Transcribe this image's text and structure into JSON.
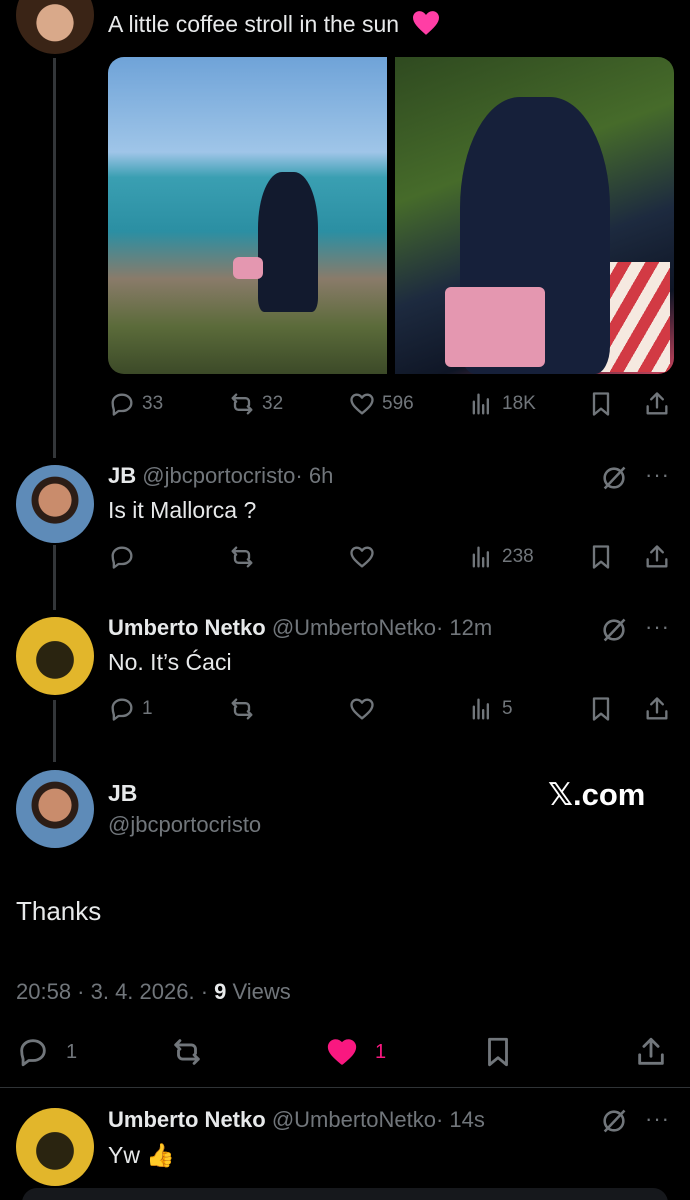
{
  "original_post": {
    "text": "A little coffee stroll in the sun",
    "emoji_icon": "pink-heart-icon",
    "stats": {
      "replies": "33",
      "reposts": "32",
      "likes": "596",
      "views": "18K"
    }
  },
  "replies": [
    {
      "name": "JB",
      "handle": "@jbcportocristo",
      "time": "· 6h",
      "text": "Is it Mallorca ?",
      "stats": {
        "replies": "",
        "views": "238"
      }
    },
    {
      "name": "Umberto Netko",
      "handle": "@UmbertoNetko",
      "time": "· 12m",
      "text": "No. It’s Ćaci",
      "stats": {
        "replies": "1",
        "views": "5"
      }
    }
  ],
  "focused_post": {
    "name": "JB",
    "handle": "@jbcportocristo",
    "watermark": "𝕏.com",
    "text": "Thanks",
    "timestamp": "20:58 · 3. 4. 2026. · ",
    "views_count": "9",
    "views_label": " Views",
    "reply_count": "1",
    "like_count": "1",
    "like_color": "#f91880"
  },
  "next_reply": {
    "name": "Umberto Netko",
    "handle": "@UmbertoNetko",
    "time": "· 14s",
    "text": "Yw 👍"
  }
}
